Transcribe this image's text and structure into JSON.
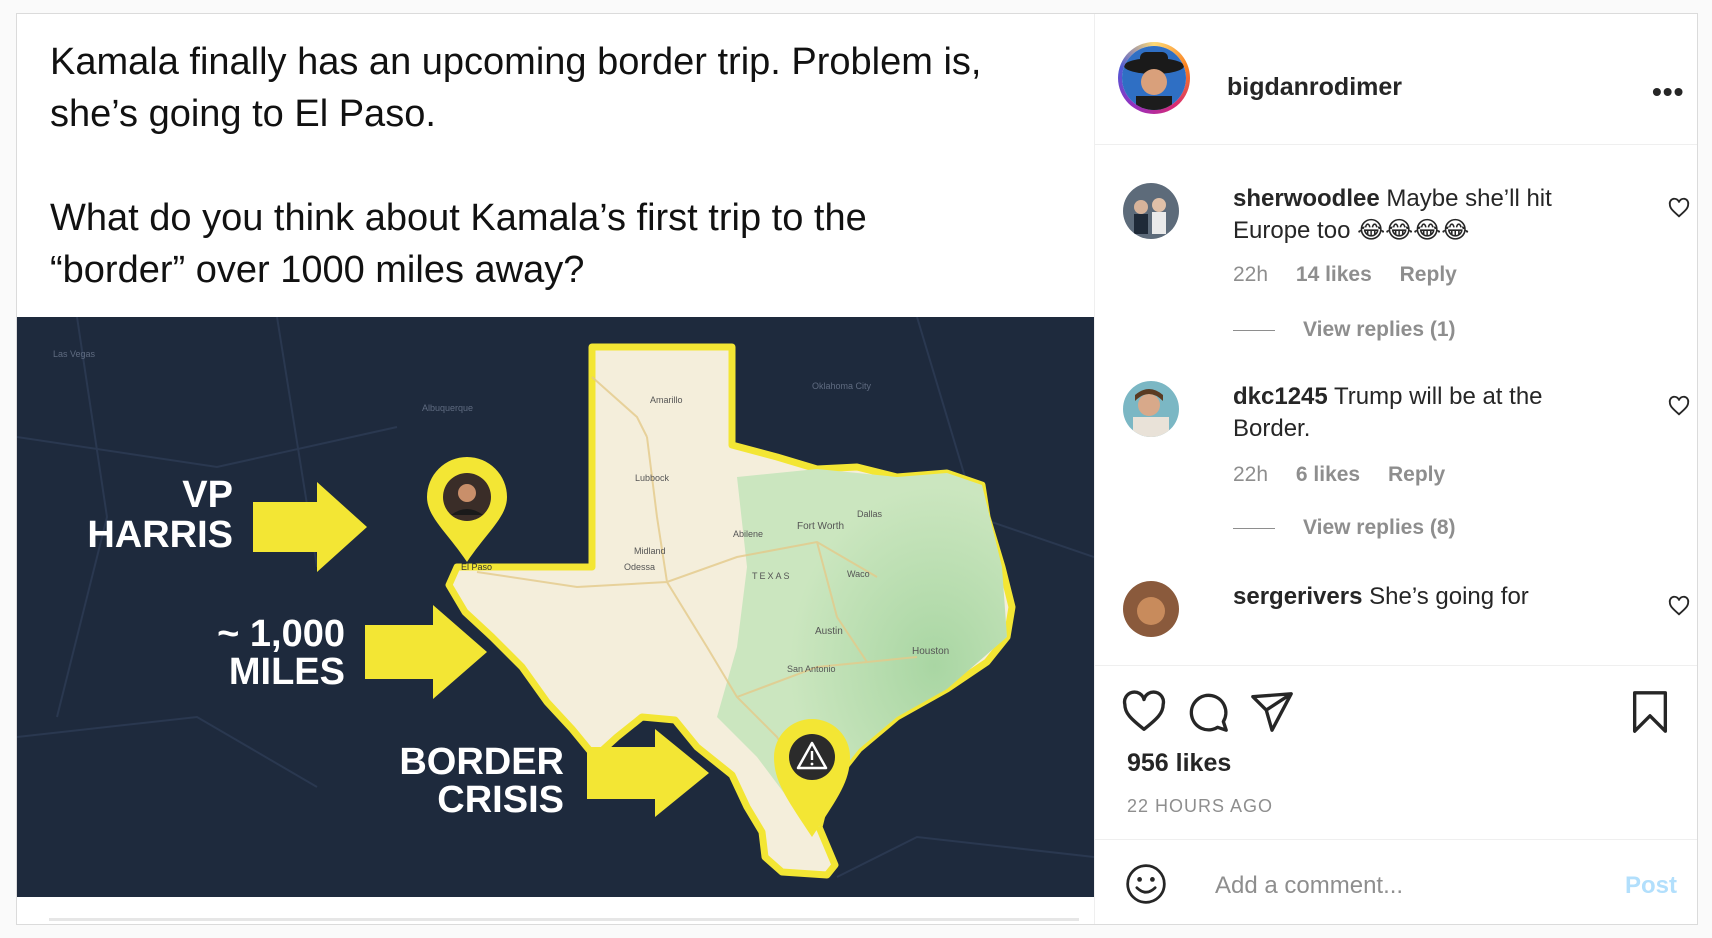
{
  "post": {
    "caption": "Kamala finally has an upcoming border trip. Problem is,\nshe’s going to El Paso.\n\nWhat do you think about Kamala’s first trip to the\n“border” over 1000 miles away?"
  },
  "map": {
    "label_vp": "VP",
    "label_harris": "HARRIS",
    "label_miles": "~ 1,000",
    "label_miles2": "MILES",
    "label_border": "BORDER",
    "label_crisis": "CRISIS",
    "city_el_paso": "El Paso",
    "city_dallas": "Dallas",
    "city_fort_worth": "Fort Worth",
    "city_austin": "Austin",
    "city_houston": "Houston",
    "city_san_antonio": "San Antonio",
    "city_lubbock": "Lubbock",
    "city_amarillo": "Amarillo",
    "city_midland": "Midland",
    "city_odessa": "Odessa",
    "city_abilene": "Abilene",
    "city_waco": "Waco",
    "state_texas": "TEXAS",
    "city_albuquerque": "Albuquerque",
    "city_oklahoma_city": "Oklahoma City",
    "city_las_vegas": "Las Vegas"
  },
  "header": {
    "username": "bigdanrodimer",
    "more": "•••"
  },
  "comments": [
    {
      "username": "sherwoodlee",
      "text": "Maybe she’ll hit Europe too 😂😂😂😂",
      "time": "22h",
      "likes": "14 likes",
      "reply": "Reply",
      "view_replies": "View replies (1)"
    },
    {
      "username": "dkc1245",
      "text": "Trump will be at the Border.",
      "time": "22h",
      "likes": "6 likes",
      "reply": "Reply",
      "view_replies": "View replies (8)"
    },
    {
      "username": "sergerivers",
      "text": "She’s going for"
    }
  ],
  "stats": {
    "likes": "956 likes",
    "timestamp": "22 HOURS AGO"
  },
  "comment_box": {
    "placeholder": "Add a comment...",
    "post_label": "Post"
  },
  "colors": {
    "map_background": "#1e2a3d",
    "texas_land": "#f4eedb",
    "texas_green": "#bfe0b6",
    "highlight_yellow": "#f3e634",
    "post_button_disabled": "#b2dffc"
  }
}
